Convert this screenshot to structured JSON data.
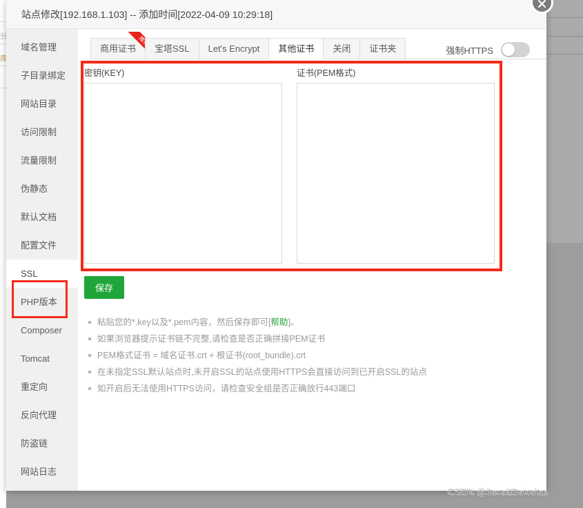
{
  "dialog": {
    "title": "站点修改[192.168.1.103] -- 添加时间[2022-04-09 10:29:18]",
    "close_label": "close-icon"
  },
  "sidebar": {
    "items": [
      {
        "label": "域名管理",
        "active": false
      },
      {
        "label": "子目录绑定",
        "active": false
      },
      {
        "label": "网站目录",
        "active": false
      },
      {
        "label": "访问限制",
        "active": false
      },
      {
        "label": "流量限制",
        "active": false
      },
      {
        "label": "伪静态",
        "active": false
      },
      {
        "label": "默认文档",
        "active": false
      },
      {
        "label": "配置文件",
        "active": false
      },
      {
        "label": "SSL",
        "active": true
      },
      {
        "label": "PHP版本",
        "active": false
      },
      {
        "label": "Composer",
        "active": false
      },
      {
        "label": "Tomcat",
        "active": false
      },
      {
        "label": "重定向",
        "active": false
      },
      {
        "label": "反向代理",
        "active": false
      },
      {
        "label": "防盗链",
        "active": false
      },
      {
        "label": "网站日志",
        "active": false
      }
    ]
  },
  "tabs": [
    {
      "label": "商用证书",
      "active": false,
      "ribbon": "推荐"
    },
    {
      "label": "宝塔SSL",
      "active": false,
      "ribbon": ""
    },
    {
      "label": "Let's Encrypt",
      "active": false,
      "ribbon": ""
    },
    {
      "label": "其他证书",
      "active": true,
      "ribbon": ""
    },
    {
      "label": "关闭",
      "active": false,
      "ribbon": ""
    },
    {
      "label": "证书夹",
      "active": false,
      "ribbon": ""
    }
  ],
  "https": {
    "label": "强制HTTPS",
    "enabled": false
  },
  "form": {
    "key_label": "密钥(KEY)",
    "key_value": "",
    "key_placeholder": "",
    "pem_label": "证书(PEM格式)",
    "pem_value": "",
    "pem_placeholder": "",
    "save_label": "保存"
  },
  "tips": {
    "items": [
      {
        "text_before": "粘贴您的*.key以及*.pem内容，然后保存即可[",
        "link": "帮助",
        "text_after": "]。"
      },
      {
        "text_before": "如果浏览器提示证书链不完整,请检查是否正确拼接PEM证书",
        "link": "",
        "text_after": ""
      },
      {
        "text_before": "PEM格式证书 = 域名证书.crt + 根证书(root_bundle).crt",
        "link": "",
        "text_after": ""
      },
      {
        "text_before": "在未指定SSL默认站点时,未开启SSL的站点使用HTTPS会直接访问到已开启SSL的站点",
        "link": "",
        "text_after": ""
      },
      {
        "text_before": "如开启后无法使用HTTPS访问，请检查安全组是否正确放行443端口",
        "link": "",
        "text_after": ""
      }
    ]
  },
  "watermark": {
    "text": "CSDN @Java&Deivelop"
  },
  "background": {
    "left_labels": [
      "分",
      "库"
    ]
  },
  "colors": {
    "accent_red": "#f42a19",
    "save_green": "#20a53a",
    "link_green": "#22a53b",
    "ribbon_red": "#e8241a"
  }
}
